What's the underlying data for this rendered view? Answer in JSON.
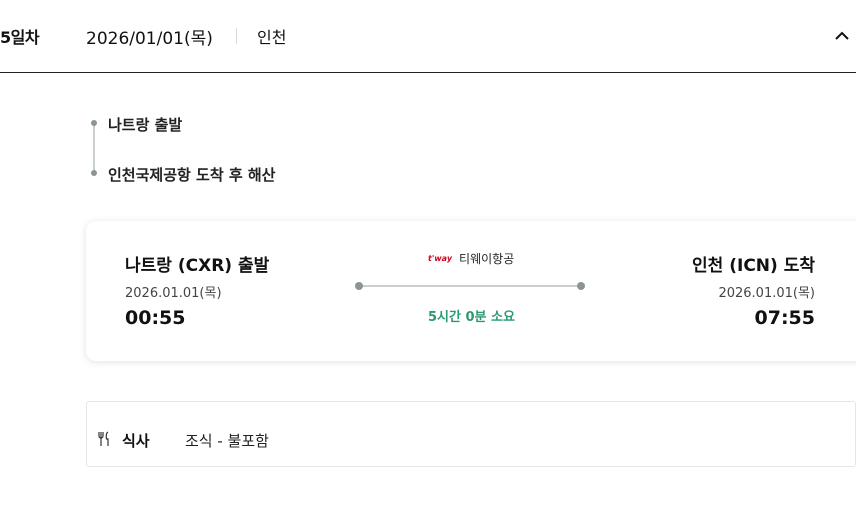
{
  "header": {
    "day_label": "5일차",
    "date": "2026/01/01(목)",
    "city": "인천"
  },
  "timeline": {
    "items": [
      {
        "label": "나트랑 출발"
      },
      {
        "label": "인천국제공항 도착 후 해산"
      }
    ]
  },
  "flight": {
    "departure": {
      "title": "나트랑 (CXR) 출발",
      "date": "2026.01.01(목)",
      "time": "00:55"
    },
    "arrival": {
      "title": "인천 (ICN) 도착",
      "date": "2026.01.01(목)",
      "time": "07:55"
    },
    "airline": {
      "logo_text": "t'way",
      "name": "티웨이항공"
    },
    "duration": "5시간 0분 소요",
    "colors": {
      "duration": "#2c9a70",
      "airline_logo": "#d0021b"
    }
  },
  "meal": {
    "icon": "fork-knife-icon",
    "label": "식사",
    "value": "조식 - 불포함"
  }
}
